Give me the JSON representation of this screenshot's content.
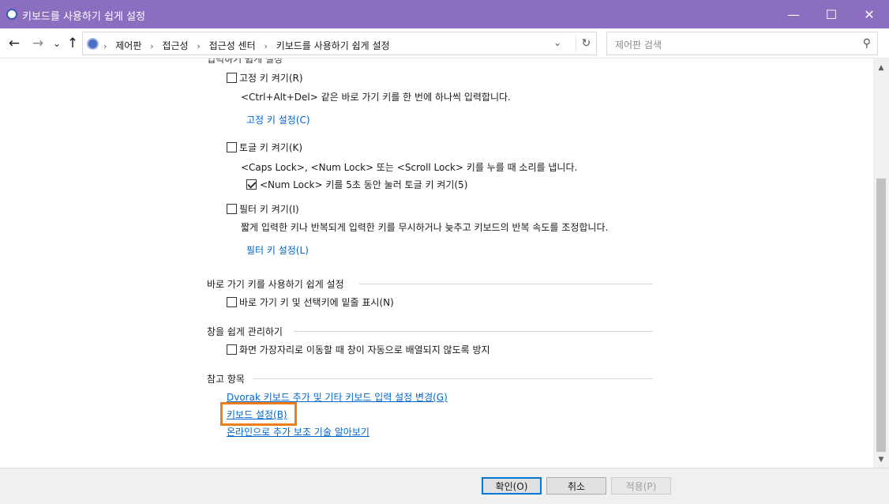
{
  "window": {
    "title": "키보드를 사용하기 쉽게 설정",
    "minimize": "—",
    "maximize": "☐",
    "close": "✕"
  },
  "nav": {
    "back": "←",
    "forward": "→",
    "recent": "⌄",
    "up": "↑",
    "breadcrumbs": [
      "제어판",
      "접근성",
      "접근성 센터",
      "키보드를 사용하기 쉽게 설정"
    ],
    "separator": "›",
    "dropdown": "⌄",
    "refresh": "↻",
    "search_placeholder": "제어판 검색",
    "search_icon": "⚲"
  },
  "content": {
    "partial_heading": "입력하기 쉽게 설정",
    "sticky": {
      "label": "고정 키 켜기(R)",
      "checked": false,
      "desc": "<Ctrl+Alt+Del> 같은 바로 가기 키를 한 번에 하나씩 입력합니다.",
      "link": "고정 키 설정(C)"
    },
    "toggle": {
      "label": "토글 키 켜기(K)",
      "checked": false,
      "desc": "<Caps Lock>, <Num Lock> 또는 <Scroll Lock> 키를 누를 때 소리를 냅니다.",
      "sub_label": "<Num Lock> 키를 5초 동안 눌러 토글 키 켜기(5)",
      "sub_checked": true
    },
    "filter": {
      "label": "필터 키 켜기(I)",
      "checked": false,
      "desc": "짧게 입력한 키나 반복되게 입력한 키를 무시하거나 늦추고 키보드의 반복 속도를 조정합니다.",
      "link": "필터 키 설정(L)"
    },
    "shortcuts": {
      "heading": "바로 가기 키를 사용하기 쉽게 설정",
      "label": "바로 가기 키 및 선택키에 밑줄 표시(N)",
      "checked": false
    },
    "windows": {
      "heading": "창을 쉽게 관리하기",
      "label": "화면 가장자리로 이동할 때 창이 자동으로 배열되지 않도록 방지",
      "checked": false
    },
    "see_also": {
      "heading": "참고 항목",
      "links": [
        "Dvorak 키보드 추가 및 기타 키보드 입력 설정 변경(G)",
        "키보드 설정(B)",
        "온라인으로 추가 보조 기술 알아보기"
      ]
    }
  },
  "scroll": {
    "up": "▲",
    "down": "▼"
  },
  "footer": {
    "ok": "확인(O)",
    "cancel": "취소",
    "apply": "적용(P)"
  },
  "colors": {
    "titlebar": "#8b6ec0",
    "link": "#0066cc",
    "highlight": "#f07c1a"
  }
}
